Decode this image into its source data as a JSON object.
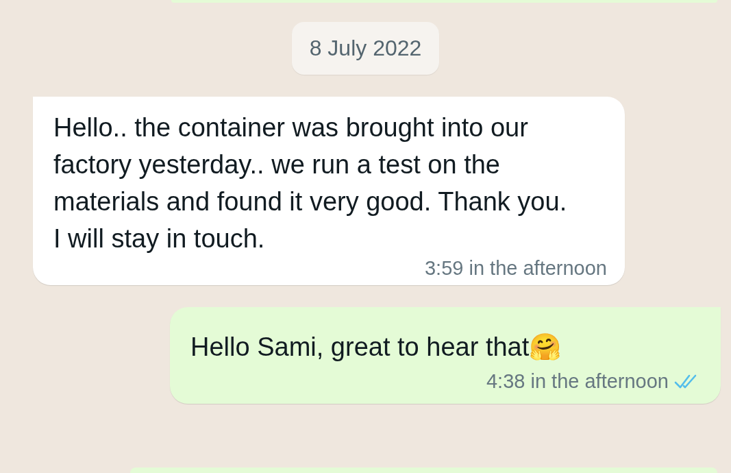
{
  "date_divider": "8 July 2022",
  "messages": [
    {
      "kind": "incoming",
      "text": "Hello.. the container was brought into our factory yesterday.. we run a test on the materials and found it very good. Thank you. I will stay in touch.",
      "time": "3:59 in the afternoon"
    },
    {
      "kind": "outgoing",
      "text": "Hello Sami, great to hear that🤗",
      "time": "4:38 in the afternoon",
      "read": true
    }
  ]
}
